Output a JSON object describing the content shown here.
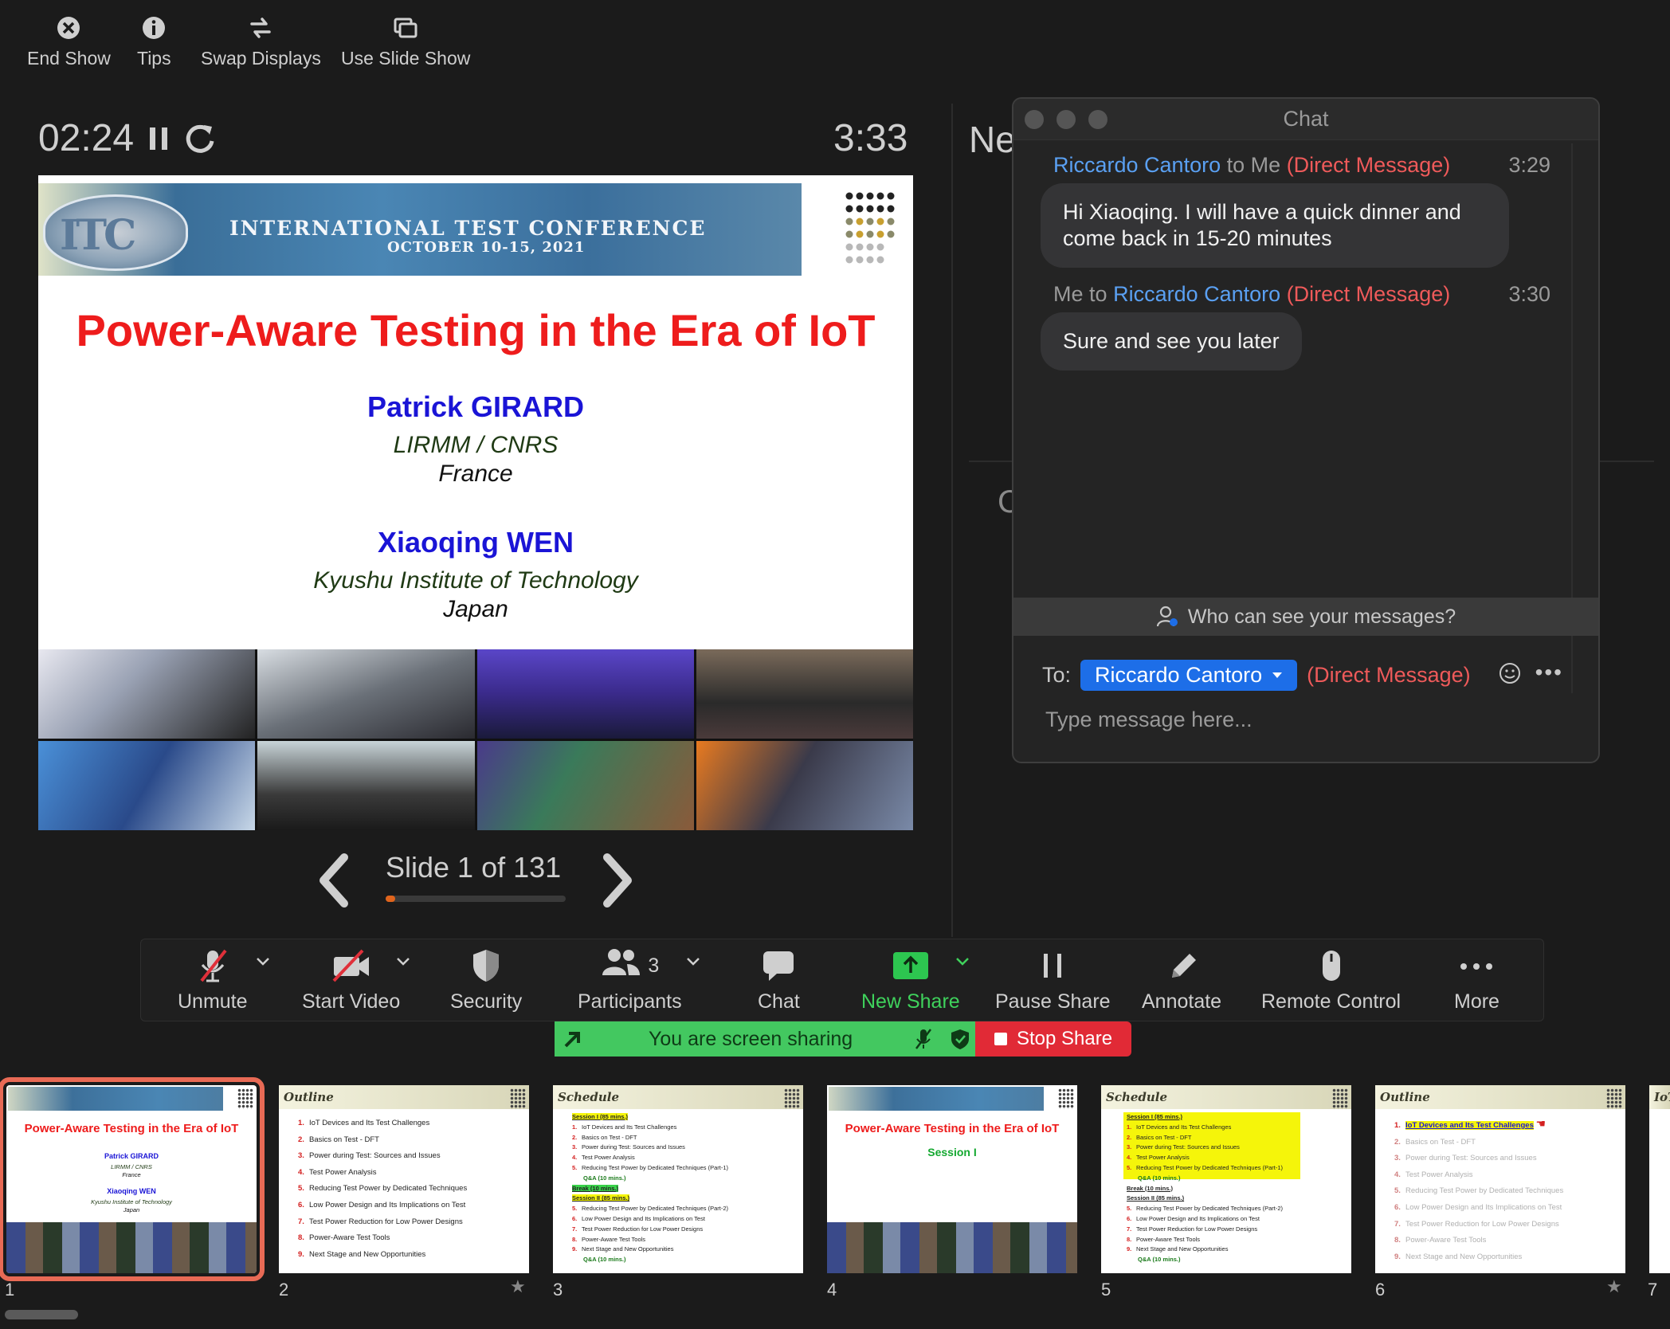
{
  "top_toolbar": {
    "end_show": "End Show",
    "tips": "Tips",
    "swap_displays": "Swap Displays",
    "use_slide_show": "Use Slide Show"
  },
  "presenter": {
    "elapsed": "02:24",
    "clock": "3:33",
    "next_label": "Ne",
    "notes_letter": "C"
  },
  "slide": {
    "banner_line1": "INTERNATIONAL TEST CONFERENCE",
    "banner_line2": "OCTOBER 10-15, 2021",
    "banner_logo": "ITC",
    "title": "Power-Aware Testing in the Era of IoT",
    "author1": "Patrick GIRARD",
    "affil1": "LIRMM / CNRS",
    "country1": "France",
    "author2": "Xiaoqing WEN",
    "affil2": "Kyushu Institute of Technology",
    "country2": "Japan"
  },
  "slide_nav": {
    "counter": "Slide 1 of 131",
    "progress_fraction": 0.0076
  },
  "chat": {
    "title": "Chat",
    "messages": [
      {
        "from": "Riccardo Cantoro",
        "connector": "to",
        "to": "Me",
        "tag": "(Direct Message)",
        "time": "3:29",
        "text": "Hi Xiaoqing. I will have a quick dinner and come back in 15-20 minutes"
      },
      {
        "from": "Me",
        "connector": "to",
        "to": "Riccardo Cantoro",
        "tag": "(Direct Message)",
        "time": "3:30",
        "text": "Sure and see you later"
      }
    ],
    "who_can_see": "Who can see your messages?",
    "to_label": "To:",
    "recipient": "Riccardo Cantoro",
    "recipient_tag": "(Direct Message)",
    "input_placeholder": "Type message here..."
  },
  "meeting_toolbar": {
    "unmute": "Unmute",
    "start_video": "Start Video",
    "security": "Security",
    "participants": "Participants",
    "participants_count": "3",
    "chat": "Chat",
    "new_share": "New Share",
    "pause_share": "Pause Share",
    "annotate": "Annotate",
    "remote_control": "Remote Control",
    "more": "More"
  },
  "share_status": {
    "text": "You are screen sharing",
    "stop": "Stop Share"
  },
  "thumbnails": [
    {
      "num": "1",
      "title": "Power-Aware Testing in the Era of IoT",
      "author1": "Patrick GIRARD",
      "affil1": "LIRMM / CNRS",
      "country1": "France",
      "author2": "Xiaoqing WEN",
      "affil2": "Kyushu Institute of Technology",
      "country2": "Japan"
    },
    {
      "num": "2",
      "heading": "Outline",
      "items": [
        "IoT Devices and Its Test Challenges",
        "Basics on Test - DFT",
        "Power during Test: Sources and Issues",
        "Test Power Analysis",
        "Reducing Test Power by Dedicated Techniques",
        "Low Power Design and Its Implications on Test",
        "Test Power Reduction for Low Power Designs",
        "Power-Aware Test Tools",
        "Next Stage and New Opportunities"
      ]
    },
    {
      "num": "3",
      "heading": "Schedule",
      "session1": "Session I (85 mins.)",
      "items1": [
        "IoT Devices and Its Test Challenges",
        "Basics on Test - DFT",
        "Power during Test: Sources and Issues",
        "Test Power Analysis",
        "Reducing Test Power by Dedicated Techniques (Part-1)"
      ],
      "qa1": "Q&A (10 mins.)",
      "break": "Break (10 mins.)",
      "session2": "Session II (85 mins.)",
      "items2": [
        "Reducing Test Power by Dedicated Techniques (Part-2)",
        "Low Power Design and Its Implications on Test",
        "Test Power Reduction for Low Power Designs",
        "Power-Aware Test Tools",
        "Next Stage and New Opportunities"
      ],
      "qa2": "Q&A (10 mins.)"
    },
    {
      "num": "4",
      "title": "Power-Aware Testing in the Era of IoT",
      "subtitle": "Session I"
    },
    {
      "num": "5",
      "heading": "Schedule",
      "session1": "Session I (85 mins.)",
      "break": "Break (10 mins.)",
      "session2": "Session II (85 mins.)",
      "qa1": "Q&A (10 mins.)",
      "qa2": "Q&A (10 mins.)"
    },
    {
      "num": "6",
      "heading": "Outline",
      "first": "IoT Devices and Its Test Challenges"
    },
    {
      "num": "7",
      "heading": "IoT"
    }
  ]
}
